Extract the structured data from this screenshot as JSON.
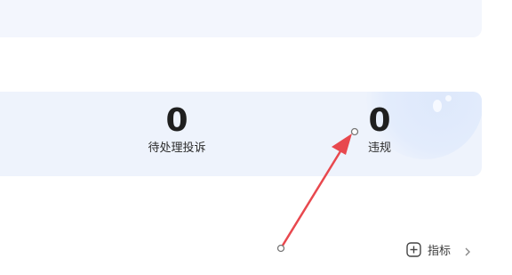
{
  "stats": {
    "pending_complaints": {
      "value": "0",
      "label": "待处理投诉"
    },
    "violations": {
      "value": "0",
      "label": "违规"
    }
  },
  "metrics_button": {
    "label": "指标",
    "icon": "plus-square-icon",
    "trailing_icon": "chevron-right-icon"
  },
  "annotation": {
    "type": "arrow",
    "color": "#e8484e"
  }
}
